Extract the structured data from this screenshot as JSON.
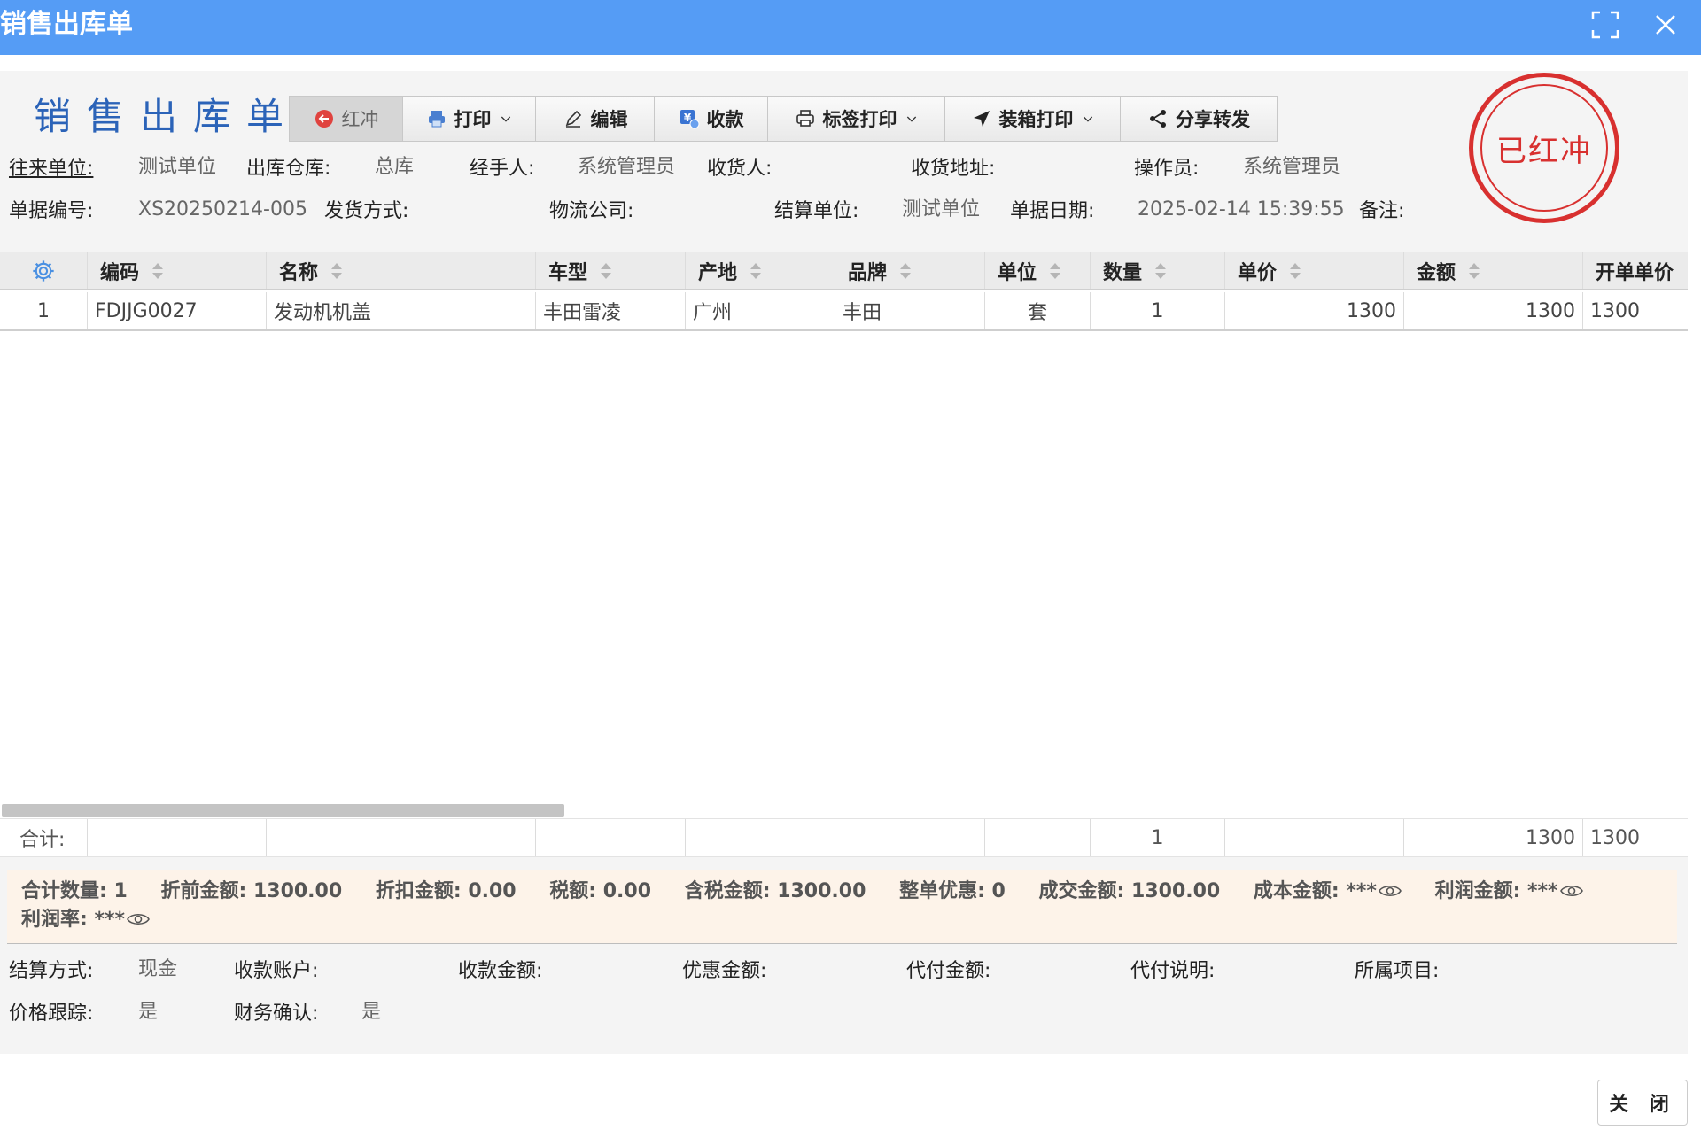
{
  "window": {
    "title": "销售出库单"
  },
  "doc_title": "销售出库单",
  "toolbar": {
    "red_reverse": "红冲",
    "print": "打印",
    "edit": "编辑",
    "receive": "收款",
    "label_print": "标签打印",
    "box_print": "装箱打印",
    "share": "分享转发"
  },
  "stamp": {
    "text": "已红冲",
    "color": "#d8302f"
  },
  "info": {
    "partner_label": "往来单位:",
    "partner": "测试单位",
    "warehouse_label": "出库仓库:",
    "warehouse": "总库",
    "handler_label": "经手人:",
    "handler": "系统管理员",
    "receiver_label": "收货人:",
    "receiver": "",
    "address_label": "收货地址:",
    "address": "",
    "operator_label": "操作员:",
    "operator": "系统管理员",
    "doc_no_label": "单据编号:",
    "doc_no": "XS20250214-005",
    "ship_method_label": "发货方式:",
    "ship_method": "",
    "logistics_label": "物流公司:",
    "logistics": "",
    "settle_unit_label": "结算单位:",
    "settle_unit": "测试单位",
    "doc_date_label": "单据日期:",
    "doc_date": "2025-02-14 15:39:55",
    "remark_label": "备注:",
    "remark": ""
  },
  "table": {
    "columns": [
      "编码",
      "名称",
      "车型",
      "产地",
      "品牌",
      "单位",
      "数量",
      "单价",
      "金额",
      "开单单价"
    ],
    "rows": [
      {
        "index": "1",
        "code": "FDJJG0027",
        "name": "发动机机盖",
        "model": "丰田雷凌",
        "origin": "广州",
        "brand": "丰田",
        "unit": "套",
        "qty": "1",
        "price": "1300",
        "amount": "1300",
        "order_price": "1300"
      }
    ],
    "total_label": "合计:",
    "total_qty": "1",
    "total_amount": "1300",
    "total_order_price": "1300"
  },
  "summary": {
    "qty_label": "合计数量:",
    "qty": "1",
    "pre_discount_label": "折前金额:",
    "pre_discount": "1300.00",
    "discount_label": "折扣金额:",
    "discount": "0.00",
    "tax_label": "税额:",
    "tax": "0.00",
    "taxed_label": "含税金额:",
    "taxed": "1300.00",
    "whole_discount_label": "整单优惠:",
    "whole_discount": "0",
    "deal_label": "成交金额:",
    "deal": "1300.00",
    "cost_label": "成本金额:",
    "cost": "***",
    "profit_label": "利润金额:",
    "profit": "***",
    "profit_rate_label": "利润率:",
    "profit_rate": "***"
  },
  "payment": {
    "settle_method_label": "结算方式:",
    "settle_method": "现金",
    "account_label": "收款账户:",
    "account": "",
    "received_label": "收款金额:",
    "received": "",
    "discount_amt_label": "优惠金额:",
    "discount_amt": "",
    "agent_pay_label": "代付金额:",
    "agent_pay": "",
    "agent_note_label": "代付说明:",
    "agent_note": "",
    "project_label": "所属项目:",
    "project": "",
    "price_track_label": "价格跟踪:",
    "price_track": "是",
    "finance_label": "财务确认:",
    "finance": "是"
  },
  "footer": {
    "close": "关 闭"
  }
}
